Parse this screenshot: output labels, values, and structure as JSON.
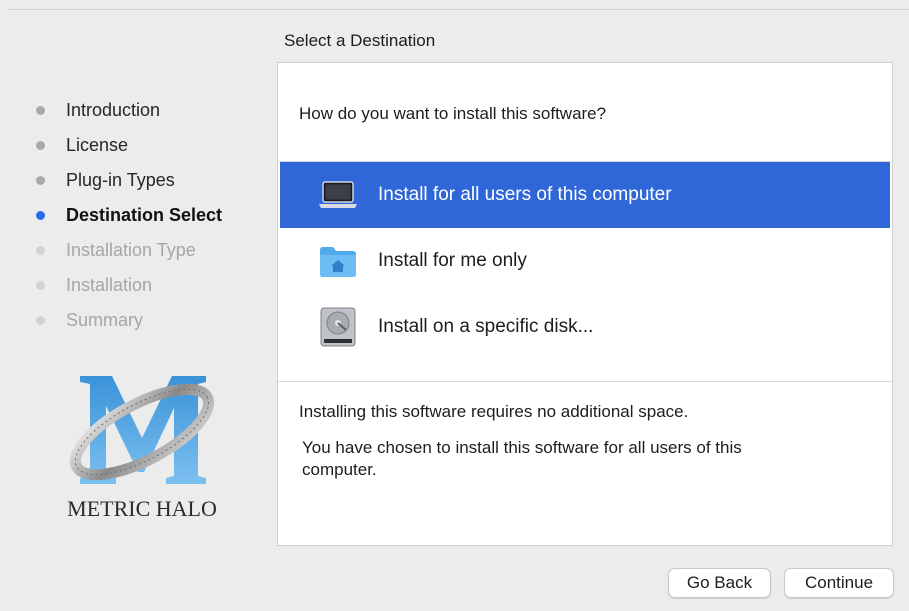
{
  "header": {
    "title": "Select a Destination"
  },
  "steps": [
    {
      "label": "Introduction",
      "state": "done"
    },
    {
      "label": "License",
      "state": "done"
    },
    {
      "label": "Plug-in Types",
      "state": "done"
    },
    {
      "label": "Destination Select",
      "state": "current"
    },
    {
      "label": "Installation Type",
      "state": "future"
    },
    {
      "label": "Installation",
      "state": "future"
    },
    {
      "label": "Summary",
      "state": "future"
    }
  ],
  "logo": {
    "text": "METRIC HALO",
    "icon": "metric-halo-logo"
  },
  "main": {
    "question": "How do you want to install this software?",
    "options": [
      {
        "label": "Install for all users of this computer",
        "icon": "laptop-icon",
        "selected": true
      },
      {
        "label": "Install for me only",
        "icon": "home-folder-icon",
        "selected": false
      },
      {
        "label": "Install on a specific disk...",
        "icon": "hard-disk-icon",
        "selected": false
      }
    ],
    "info_space": "Installing this software requires no additional space.",
    "info_choice": "You have chosen to install this software for all users of this computer."
  },
  "buttons": {
    "back": "Go Back",
    "continue": "Continue"
  },
  "colors": {
    "accent": "#2f66d8",
    "current_step_dot": "#2a6cf0",
    "background": "#ececec"
  }
}
